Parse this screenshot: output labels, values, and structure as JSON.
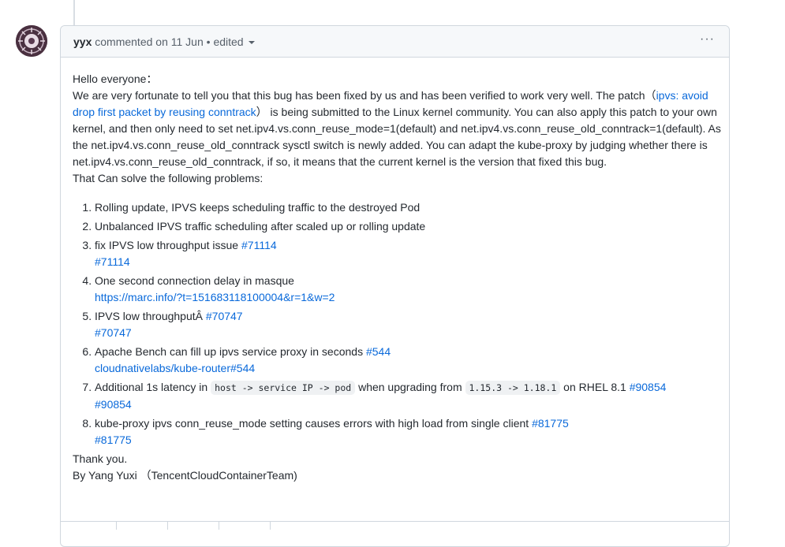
{
  "comment": {
    "author": "yyx",
    "action": "commented on",
    "date": "11 Jun",
    "separator": "•",
    "edited": "edited",
    "menu_label": "···"
  },
  "body": {
    "greeting": "Hello everyone：",
    "p1_before": "We are very fortunate to tell you that this bug has been fixed by us and has been verified to work very well. The patch（",
    "patch_link": "ipvs: avoid drop first packet by reusing conntrack",
    "p1_after": "） is being submitted to the Linux kernel community. You can also apply this patch to your own kernel, and then only need to set net.ipv4.vs.conn_reuse_mode=1(default) and net.ipv4.vs.conn_reuse_old_conntrack=1(default). As the net.ipv4.vs.conn_reuse_old_conntrack sysctl switch is newly added. You can adapt the kube-proxy by judging whether there is net.ipv4.vs.conn_reuse_old_conntrack, if so, it means that the current kernel is the version that fixed this bug.",
    "intro": "That Can solve the following problems:",
    "items": [
      {
        "text": "Rolling update, IPVS keeps scheduling traffic to the destroyed Pod"
      },
      {
        "text": "Unbalanced IPVS traffic scheduling after scaled up or rolling update"
      },
      {
        "text": "fix IPVS low throughput issue ",
        "link": "#71114",
        "sub": "#71114"
      },
      {
        "text": "One second connection delay in masque",
        "sub": "https://marc.info/?t=151683118100004&r=1&w=2"
      },
      {
        "text": "IPVS low throughputÂ ",
        "link": "#70747",
        "sub": "#70747"
      },
      {
        "text": "Apache Bench can fill up ipvs service proxy in seconds ",
        "link": "#544",
        "sub": "cloudnativelabs/kube-router#544"
      },
      {
        "text_a": "Additional 1s latency in ",
        "code1": "host -> service IP -> pod",
        "text_b": " when upgrading from ",
        "code2": "1.15.3 -> 1.18.1",
        "text_c": " on RHEL 8.1 ",
        "link": "#90854",
        "sub": "#90854"
      },
      {
        "text": "kube-proxy ipvs conn_reuse_mode setting causes errors with high load from single client ",
        "link": "#81775",
        "sub": "#81775"
      }
    ],
    "thanks": "Thank you.",
    "signature": "By Yang Yuxi （TencentCloudContainerTeam)"
  },
  "colors": {
    "link": "#0969da",
    "border": "#d0d7de",
    "header_bg": "#f6f8fa"
  },
  "icons": {
    "avatar": "avatar",
    "menu": "kebab-horizontal-icon",
    "caret": "caret-down-icon"
  }
}
